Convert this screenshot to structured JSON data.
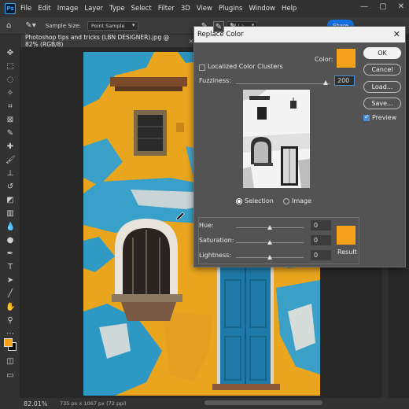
{
  "menubar": {
    "logo": "Ps",
    "items": [
      "File",
      "Edit",
      "Image",
      "Layer",
      "Type",
      "Select",
      "Filter",
      "3D",
      "View",
      "Plugins",
      "Window",
      "Help"
    ]
  },
  "options": {
    "sample_size_label": "Sample Size:",
    "sample_size_value": "Point Sample",
    "sample_layers_value": "All La",
    "share_label": "Share"
  },
  "document": {
    "tab_title": "Photoshop tips and tricks (LBN DESIGNER).jpg @ 82% (RGB/8)",
    "zoom": "82.01%",
    "size_info": "735 px x 1067 px (72 ppi)"
  },
  "dialog": {
    "title": "Replace Color",
    "localized_label": "Localized Color Clusters",
    "color_label": "Color:",
    "fuzziness_label": "Fuzziness:",
    "fuzziness_value": "200",
    "selection_label": "Selection",
    "image_label": "Image",
    "hue_label": "Hue:",
    "hue_value": "0",
    "saturation_label": "Saturation:",
    "saturation_value": "0",
    "lightness_label": "Lightness:",
    "lightness_value": "0",
    "result_label": "Result",
    "buttons": {
      "ok": "OK",
      "cancel": "Cancel",
      "load": "Load...",
      "save": "Save...",
      "preview": "Preview"
    },
    "color_hex": "#f8a11d",
    "result_hex": "#f8a11d"
  },
  "tools": [
    "move-icon",
    "marquee-icon",
    "lasso-icon",
    "quick-select-icon",
    "crop-icon",
    "frame-icon",
    "eyedropper-icon",
    "healing-icon",
    "brush-icon",
    "stamp-icon",
    "history-brush-icon",
    "eraser-icon",
    "gradient-icon",
    "blur-icon",
    "dodge-icon",
    "pen-icon",
    "type-icon",
    "path-select-icon",
    "line-icon",
    "hand-icon",
    "zoom-icon",
    "more-icon"
  ]
}
